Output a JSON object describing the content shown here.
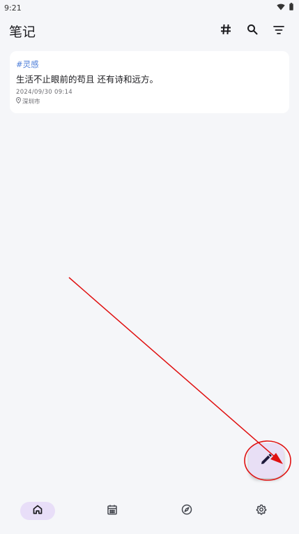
{
  "status_bar": {
    "time": "9:21",
    "icons": [
      "wifi-icon",
      "battery-icon"
    ]
  },
  "app_bar": {
    "title": "笔记",
    "actions": [
      "hashtag-icon",
      "search-icon",
      "filter-icon"
    ]
  },
  "notes": [
    {
      "tag": "#灵感",
      "body": "生活不止眼前的苟且 还有诗和远方。",
      "time": "2024/09/30 09:14",
      "location": "深圳市"
    }
  ],
  "fab": {
    "icon": "pencil-icon"
  },
  "bottom_nav": {
    "items": [
      {
        "icon": "home-icon",
        "active": true
      },
      {
        "icon": "calendar-icon",
        "active": false
      },
      {
        "icon": "compass-icon",
        "active": false
      },
      {
        "icon": "settings-icon",
        "active": false
      }
    ]
  },
  "colors": {
    "background": "#f5f6f9",
    "tag": "#4f7fd9",
    "fab": "#e8dff5",
    "nav_active": "#e8def8",
    "annotation": "#e01010"
  }
}
